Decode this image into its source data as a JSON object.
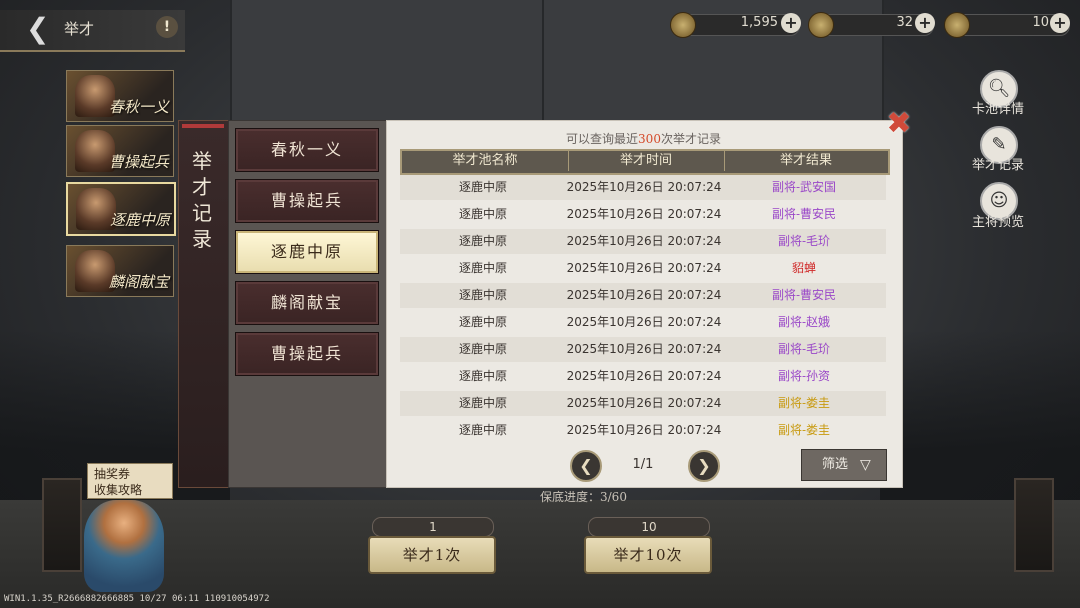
{
  "header": {
    "title": "举才",
    "back_icon": "back-arrow-icon",
    "help_icon": "!"
  },
  "currencies": [
    {
      "icon": "coin-icon",
      "value": "1,595"
    },
    {
      "icon": "jade-icon",
      "value": "32"
    },
    {
      "icon": "ticket-icon",
      "value": "10"
    }
  ],
  "banners": [
    "春秋一义",
    "曹操起兵",
    "逐鹿中原",
    "麟阁献宝"
  ],
  "right_menu": [
    {
      "label": "卡池详情",
      "icon": "magnifier-icon"
    },
    {
      "label": "举才记录",
      "icon": "brush-icon"
    },
    {
      "label": "主将预览",
      "icon": "portrait-icon"
    }
  ],
  "modal": {
    "tab_title": "举才记录",
    "pools": [
      "春秋一义",
      "曹操起兵",
      "逐鹿中原",
      "麟阁献宝",
      "曹操起兵"
    ],
    "active_pool_index": 2,
    "hint_prefix": "可以查询最近",
    "hint_num": "300",
    "hint_suffix": "次举才记录",
    "columns": [
      "举才池名称",
      "举才时间",
      "举才结果"
    ],
    "rows": [
      {
        "pool": "逐鹿中原",
        "time": "2025年10月26日 20:07:24",
        "result": "副将-武安国",
        "color": "#9a48c8"
      },
      {
        "pool": "逐鹿中原",
        "time": "2025年10月26日 20:07:24",
        "result": "副将-曹安民",
        "color": "#9a48c8"
      },
      {
        "pool": "逐鹿中原",
        "time": "2025年10月26日 20:07:24",
        "result": "副将-毛玠",
        "color": "#9a48c8"
      },
      {
        "pool": "逐鹿中原",
        "time": "2025年10月26日 20:07:24",
        "result": "貂蝉",
        "color": "#d02a2a"
      },
      {
        "pool": "逐鹿中原",
        "time": "2025年10月26日 20:07:24",
        "result": "副将-曹安民",
        "color": "#9a48c8"
      },
      {
        "pool": "逐鹿中原",
        "time": "2025年10月26日 20:07:24",
        "result": "副将-赵娥",
        "color": "#9a48c8"
      },
      {
        "pool": "逐鹿中原",
        "time": "2025年10月26日 20:07:24",
        "result": "副将-毛玠",
        "color": "#9a48c8"
      },
      {
        "pool": "逐鹿中原",
        "time": "2025年10月26日 20:07:24",
        "result": "副将-孙资",
        "color": "#9a48c8"
      },
      {
        "pool": "逐鹿中原",
        "time": "2025年10月26日 20:07:24",
        "result": "副将-娄圭",
        "color": "#c89a10"
      },
      {
        "pool": "逐鹿中原",
        "time": "2025年10月26日 20:07:24",
        "result": "副将-娄圭",
        "color": "#c89a10"
      }
    ],
    "page": "1/1",
    "filter_label": "筛选",
    "close_icon": "close-icon"
  },
  "bottom": {
    "pity": "保底进度：3/60",
    "cost1": "1",
    "cost10": "10",
    "draw1": "举才1次",
    "draw10": "举才10次",
    "voucher_line1": "抽奖券",
    "voucher_line2": "收集攻略"
  },
  "footer": "WIN1.1.35_R2666882666885 10/27 06:11 110910054972"
}
